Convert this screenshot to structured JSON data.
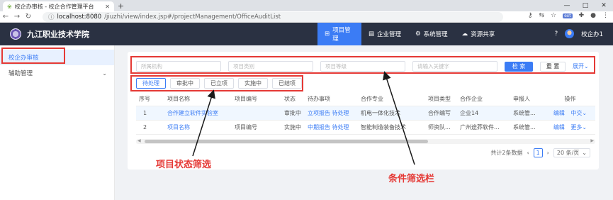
{
  "browser": {
    "tab_title": "校企办审核 - 校企合作管理平台",
    "url_host": "localhost:8080",
    "url_path": "/jiuzhi/view/index.jsp#/projectManagement/OfficeAuditList",
    "win_controls": [
      "—",
      "□",
      "✕"
    ]
  },
  "header": {
    "brand": "九江职业技术学院",
    "nav": [
      {
        "icon": "project-icon",
        "label": "项目管理"
      },
      {
        "icon": "enterprise-icon",
        "label": "企业管理"
      },
      {
        "icon": "system-icon",
        "label": "系统管理"
      },
      {
        "icon": "cloud-icon",
        "label": "资源共享"
      }
    ],
    "user": "校企办1"
  },
  "sidebar": {
    "items": [
      {
        "label": "校企办审核"
      },
      {
        "label": "辅助管理"
      }
    ]
  },
  "filters": {
    "dept_placeholder": "所属机构",
    "category_placeholder": "项目类别",
    "level_placeholder": "项目等级",
    "keyword_placeholder": "请输入关键字",
    "search_label": "检 索",
    "reset_label": "重 置",
    "expand_label": "展开"
  },
  "status_tabs": [
    "待处理",
    "审批中",
    "已立项",
    "实施中",
    "已结项"
  ],
  "table": {
    "columns": [
      "序号",
      "项目名称",
      "项目编号",
      "状态",
      "待办事项",
      "合作专业",
      "项目类型",
      "合作企业",
      "申报人",
      "操作"
    ],
    "rows": [
      {
        "no": "1",
        "name": "合作建立软件实验室",
        "code": "",
        "status": "审批中",
        "todo": "立项报告 待处理",
        "major": "机电一体化技术",
        "type": "合作编写",
        "company": "企业14",
        "applicant": "系统管...",
        "op1": "编辑",
        "op2": "中交"
      },
      {
        "no": "2",
        "name": "项目名称",
        "code": "项目编号",
        "status": "实施中",
        "todo": "中期报告 待处理",
        "major": "智能制造装备技术",
        "type": "师资队...",
        "company": "广州途莽软件...",
        "applicant": "系统管...",
        "op1": "编辑",
        "op2": "更多"
      }
    ]
  },
  "pagination": {
    "total": "共计2条数据",
    "current": "1",
    "page_size": "20 条/页"
  },
  "annotations": {
    "status_filter": "项目状态筛选",
    "condition_filter": "条件筛选栏"
  },
  "colors": {
    "accent": "#3b7cf5",
    "header_bg": "#2a3142",
    "annotation": "#e53935"
  }
}
